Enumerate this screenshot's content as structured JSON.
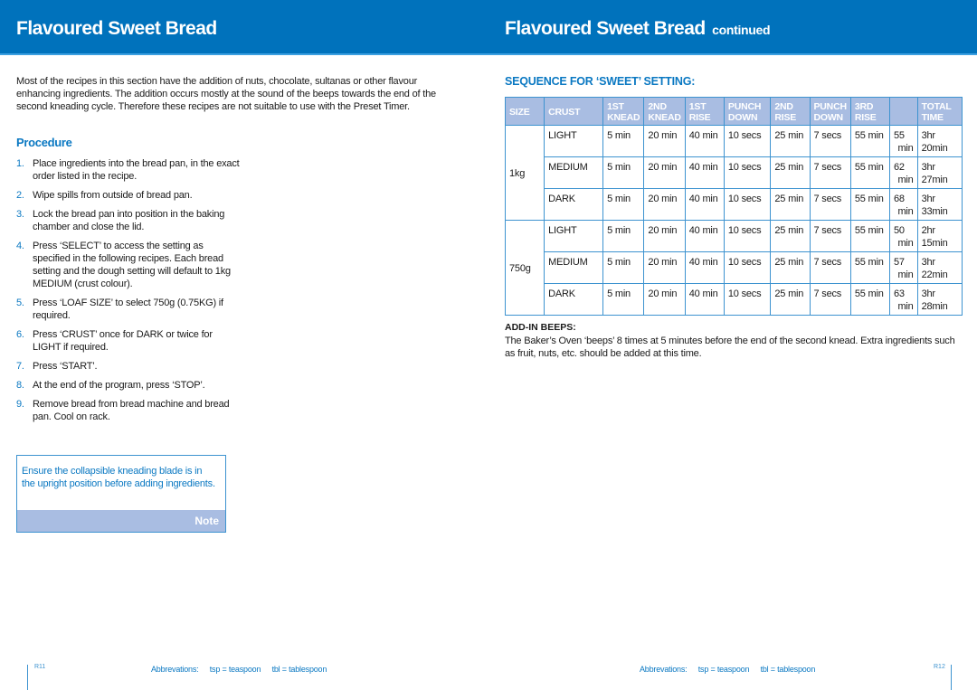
{
  "header": {
    "left_title": "Flavoured Sweet Bread",
    "right_title": "Flavoured Sweet Bread",
    "right_title_suffix": "continued",
    "band_color": "#0072bc"
  },
  "left_page": {
    "intro": "Most of the recipes in this section have the addition of nuts, chocolate, sultanas or other flavour enhancing ingredients. The addition occurs mostly at the sound of the beeps towards the end of the second kneading cycle. Therefore these recipes are not suitable to use with the Preset Timer.",
    "procedure_heading": "Procedure",
    "steps": [
      {
        "num": "1.",
        "text": "Place ingredients into the bread pan, in the exact order listed in the recipe."
      },
      {
        "num": "2.",
        "text": "Wipe spills from outside of bread pan."
      },
      {
        "num": "3.",
        "text": "Lock the bread pan into position in the baking chamber and close the lid."
      },
      {
        "num": "4.",
        "text": "Press ‘SELECT’ to access the setting as specified in the following recipes. Each bread setting and the dough setting will default to 1kg MEDIUM (crust colour)."
      },
      {
        "num": "5.",
        "text": "Press ‘LOAF SIZE’ to select 750g (0.75KG) if required."
      },
      {
        "num": "6.",
        "text": "Press ‘CRUST’ once for DARK or twice for LIGHT if required."
      },
      {
        "num": "7.",
        "text": "Press ‘START’."
      },
      {
        "num": "8.",
        "text": "At the end of the program, press ‘STOP’."
      },
      {
        "num": "9.",
        "text": "Remove bread from bread machine and bread pan. Cool on rack."
      }
    ],
    "note": {
      "text": "Ensure the collapsible kneading blade is in the upright position before adding ingredients.",
      "label": "Note"
    },
    "page_number": "R11"
  },
  "right_page": {
    "sequence_heading": "SEQUENCE FOR ‘SWEET’ SETTING:",
    "table": {
      "headers": [
        [
          "SIZE",
          ""
        ],
        [
          "CRUST",
          ""
        ],
        [
          "1ST",
          "KNEAD"
        ],
        [
          "2ND",
          "KNEAD"
        ],
        [
          "1ST",
          "RISE"
        ],
        [
          "PUNCH",
          "DOWN"
        ],
        [
          "2ND",
          "RISE"
        ],
        [
          "PUNCH",
          "DOWN"
        ],
        [
          "3RD",
          "RISE"
        ],
        [
          "",
          ""
        ],
        [
          "TOTAL",
          "TIME"
        ]
      ],
      "groups": [
        {
          "size": "1kg",
          "rows": [
            {
              "crust": "LIGHT",
              "knead1": "5 min",
              "knead2": "20 min",
              "rise1": "40 min",
              "punch1": "10 secs",
              "rise2": "25 min",
              "punch2": "7 secs",
              "rise3": "55 min",
              "bake_a": "55",
              "bake_b": "min",
              "total_a": "3hr",
              "total_b": "20min"
            },
            {
              "crust": "MEDIUM",
              "knead1": "5 min",
              "knead2": "20 min",
              "rise1": "40 min",
              "punch1": "10 secs",
              "rise2": "25 min",
              "punch2": "7 secs",
              "rise3": "55 min",
              "bake_a": "62",
              "bake_b": "min",
              "total_a": "3hr",
              "total_b": "27min"
            },
            {
              "crust": "DARK",
              "knead1": "5 min",
              "knead2": "20 min",
              "rise1": "40 min",
              "punch1": "10 secs",
              "rise2": "25 min",
              "punch2": "7 secs",
              "rise3": "55 min",
              "bake_a": "68",
              "bake_b": "min",
              "total_a": "3hr",
              "total_b": "33min"
            }
          ]
        },
        {
          "size": "750g",
          "rows": [
            {
              "crust": "LIGHT",
              "knead1": "5 min",
              "knead2": "20 min",
              "rise1": "40 min",
              "punch1": "10 secs",
              "rise2": "25 min",
              "punch2": "7 secs",
              "rise3": "55 min",
              "bake_a": "50",
              "bake_b": "min",
              "total_a": "2hr",
              "total_b": "15min"
            },
            {
              "crust": "MEDIUM",
              "knead1": "5 min",
              "knead2": "20 min",
              "rise1": "40 min",
              "punch1": "10 secs",
              "rise2": "25 min",
              "punch2": "7 secs",
              "rise3": "55 min",
              "bake_a": "57",
              "bake_b": "min",
              "total_a": "3hr",
              "total_b": "22min"
            },
            {
              "crust": "DARK",
              "knead1": "5 min",
              "knead2": "20 min",
              "rise1": "40 min",
              "punch1": "10 secs",
              "rise2": "25 min",
              "punch2": "7 secs",
              "rise3": "55 min",
              "bake_a": "63",
              "bake_b": "min",
              "total_a": "3hr",
              "total_b": "28min"
            }
          ]
        }
      ]
    },
    "add_in_heading": "ADD-IN BEEPS:",
    "add_in_text": "The Baker’s Oven ‘beeps’ 8 times at 5 minutes before the end of the second knead. Extra ingredients such as fruit, nuts, etc. should be added at this time.",
    "page_number": "R12"
  },
  "footer": {
    "abbrev_label": "Abbrevations:",
    "tsp": "tsp = teaspoon",
    "tbl": "tbl = tablespoon"
  }
}
